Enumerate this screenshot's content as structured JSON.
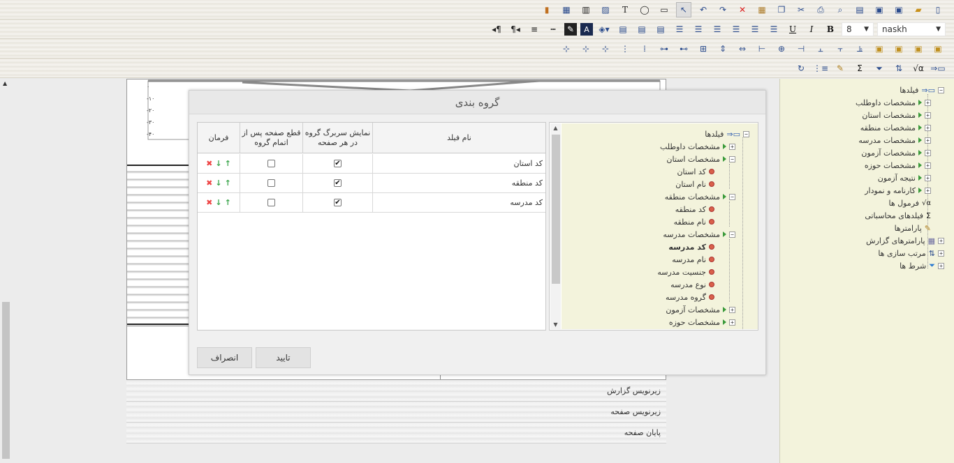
{
  "toolbar1": {
    "icons": [
      "new-file-icon",
      "open-folder-icon",
      "save-as-icon",
      "save-icon",
      "page-setup-icon",
      "preview-icon",
      "print-icon",
      "cut-icon",
      "copy-icon",
      "paste-icon",
      "delete-icon",
      "redo-icon",
      "undo-icon",
      "pointer-icon",
      "rectangle-icon",
      "ellipse-icon",
      "text-tool-icon",
      "image-icon",
      "barcode-icon",
      "table-icon",
      "chart-icon"
    ]
  },
  "toolbar2": {
    "font_name": "naskh",
    "font_size": "8",
    "bold_glyph": "B",
    "italic_glyph": "I",
    "underline_glyph": "U"
  },
  "rpanel": {
    "root": "فیلدها",
    "items": [
      "مشخصات داوطلب",
      "مشخصات استان",
      "مشخصات منطقه",
      "مشخصات مدرسه",
      "مشخصات آزمون",
      "مشخصات حوزه",
      "نتیجه آزمون",
      "کارنامه و نمودار"
    ],
    "extras": [
      "فرمول ها",
      "فیلدهای محاسباتی",
      "پارامترها",
      "پارامترهای گزارش",
      "مرتب سازی ها",
      "شرط ها"
    ]
  },
  "bands": {
    "report_footer": "زیرنویس گزارش",
    "page_footer": "زیرنویس صفحه",
    "page_end": "پایان صفحه"
  },
  "dialog": {
    "title": "گروه بندی",
    "columns": {
      "field_name": "نام فیلد",
      "show_header": "نمایش سربرگ گروه در هر صفحه",
      "page_break": "قطع صفحه پس از اتمام گروه",
      "command": "فرمان"
    },
    "rows": [
      {
        "field": "کد استان",
        "show_header": true,
        "page_break": false
      },
      {
        "field": "کد منطقه",
        "show_header": true,
        "page_break": false
      },
      {
        "field": "کد مدرسه",
        "show_header": true,
        "page_break": false
      }
    ],
    "tree": {
      "root": "فیلدها",
      "candidate": "مشخصات داوطلب",
      "province": "مشخصات استان",
      "province_code": "کد استان",
      "province_name": "نام استان",
      "region": "مشخصات منطقه",
      "region_code": "کد منطقه",
      "region_name": "نام منطقه",
      "school": "مشخصات مدرسه",
      "school_code": "کد مدرسه",
      "school_name": "نام مدرسه",
      "school_gender": "جنسیت مدرسه",
      "school_type": "نوع مدرسه",
      "school_group": "گروه مدرسه",
      "exam": "مشخصات آزمون",
      "zone": "مشخصات حوزه"
    },
    "ok_label": "تایید",
    "cancel_label": "انصراف"
  },
  "chart_axis_labels": [
    "۰",
    "-۱۰",
    "-۲۰",
    "-۳۰",
    "-۴۰"
  ]
}
